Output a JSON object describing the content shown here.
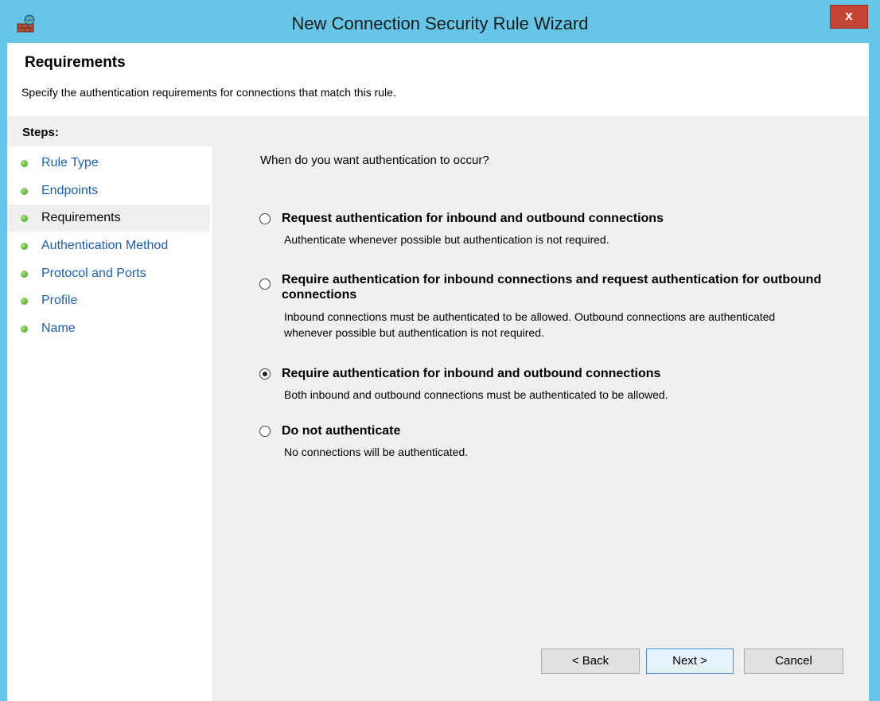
{
  "window": {
    "title": "New Connection Security Rule Wizard",
    "close_label": "x"
  },
  "header": {
    "title": "Requirements",
    "subtitle": "Specify the authentication requirements for connections that match this rule."
  },
  "sidebar": {
    "heading": "Steps:",
    "items": [
      {
        "label": "Rule Type"
      },
      {
        "label": "Endpoints"
      },
      {
        "label": "Requirements"
      },
      {
        "label": "Authentication Method"
      },
      {
        "label": "Protocol and Ports"
      },
      {
        "label": "Profile"
      },
      {
        "label": "Name"
      }
    ],
    "selected": "Requirements"
  },
  "main": {
    "question": "When do you want authentication to occur?",
    "options": [
      {
        "label": "Request authentication for inbound and outbound connections",
        "description": "Authenticate whenever possible but authentication is not required.",
        "checked": false
      },
      {
        "label": "Require authentication for inbound connections and request authentication for outbound connections",
        "description": "Inbound connections must be authenticated to be allowed. Outbound connections are authenticated whenever possible but authentication is not required.",
        "checked": false
      },
      {
        "label": "Require authentication for inbound and outbound connections",
        "description": "Both inbound and outbound connections must be authenticated to be allowed.",
        "checked": true
      },
      {
        "label": "Do not authenticate",
        "description": "No connections will be authenticated.",
        "checked": false
      }
    ]
  },
  "buttons": {
    "back": "< Back",
    "next": "Next >",
    "cancel": "Cancel"
  },
  "colors": {
    "titlebar": "#67c6e8",
    "close_button": "#c44535",
    "link_text": "#1c5fb0",
    "step_dot": "#3d9b22"
  }
}
